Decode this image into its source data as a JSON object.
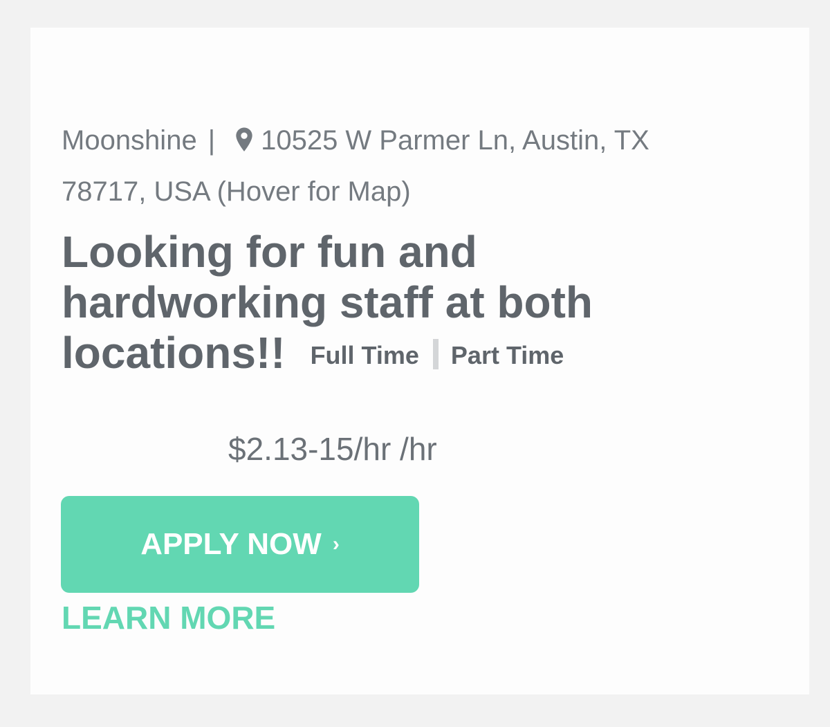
{
  "job": {
    "company": "Moonshine",
    "separator": "|",
    "address": "10525 W Parmer Ln, Austin, TX 78717, USA (Hover for Map)",
    "location_icon": "map-pin-icon",
    "title": "Looking for fun and hardworking staff at both locations!!",
    "job_types": [
      "Full Time",
      "Part Time"
    ],
    "wage": "$2.13-15/hr /hr"
  },
  "actions": {
    "apply_label": "APPLY NOW",
    "apply_chevron": "›",
    "learn_more_label": "LEARN MORE"
  },
  "colors": {
    "accent": "#62d7b2",
    "text": "#5f656b",
    "meta_text": "#747a80",
    "background": "#f2f2f2",
    "card": "#fdfdfd"
  }
}
